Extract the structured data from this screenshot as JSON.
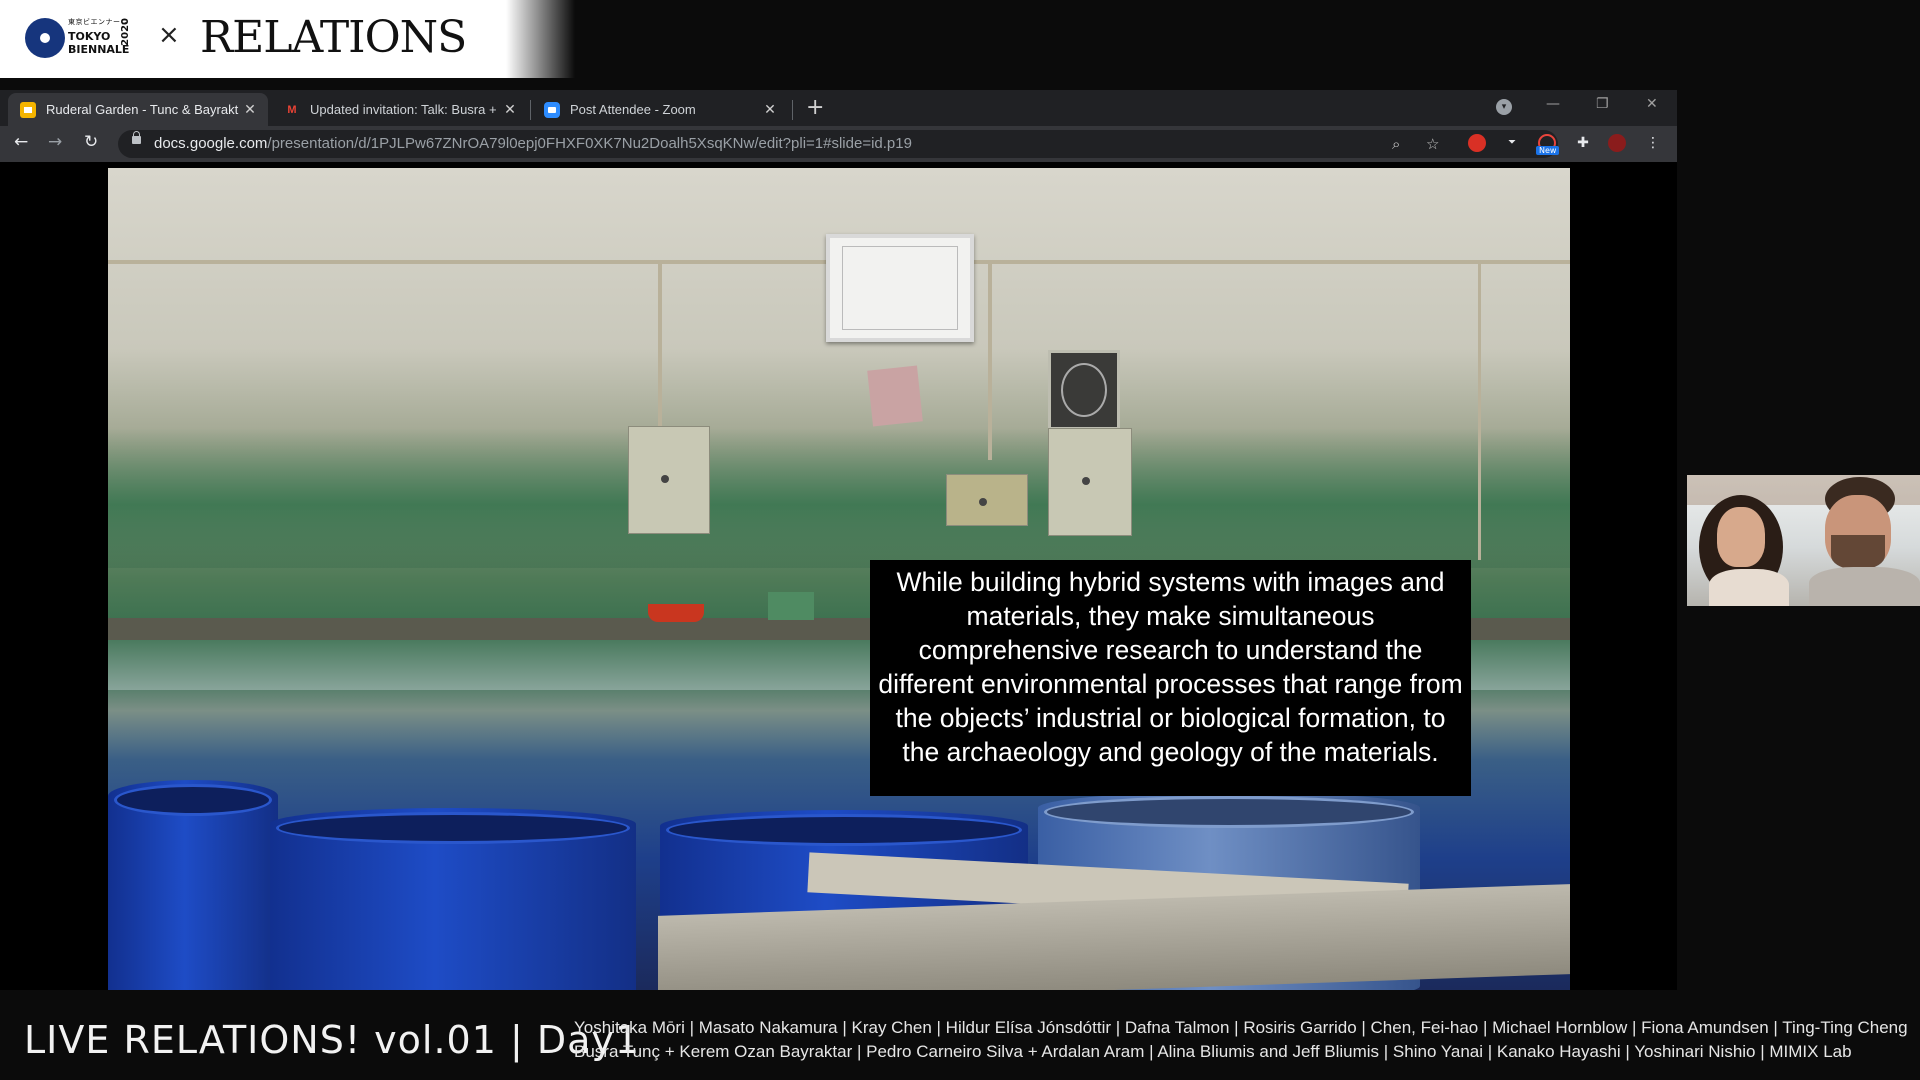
{
  "banner": {
    "logo_jp": "東京ビエンナーレ",
    "logo_line1": "TOKYO",
    "logo_line2": "BIENNALE",
    "logo_year": "2020",
    "cross": "×",
    "title": "RELATIONS"
  },
  "browser": {
    "tabs": [
      {
        "title": "Ruderal Garden - Tunc & Bayrakt",
        "favicon": "slides-icon",
        "active": true
      },
      {
        "title": "Updated invitation: Talk: Busra +",
        "favicon": "gmail-icon",
        "active": false
      },
      {
        "title": "Post Attendee - Zoom",
        "favicon": "zoom-icon",
        "active": false
      }
    ],
    "close_glyph": "✕",
    "new_tab_glyph": "+",
    "url_host": "docs.google.com",
    "url_path": "/presentation/d/1PJLPw67ZNrOA79l0epj0FHXF0XK7Nu2Doalh5XsqKNw/edit?pli=1#slide=id.p19",
    "ext_badge": "New"
  },
  "slide": {
    "caption": "While building hybrid systems with images and materials, they make simultaneous comprehensive research to understand the different environmental processes that range from the objects’ industrial or biological formation, to the archaeology and geology of the materials."
  },
  "footer": {
    "event_title": "LIVE RELATIONS! vol.01 | Day1",
    "participants_line1": "Yoshitaka Mōri | Masato Nakamura | Kray Chen | Hildur Elísa Jónsdóttir | Dafna Talmon | Rosiris Garrido | Chen, Fei-hao | Michael Hornblow | Fiona Amundsen | Ting-Ting Cheng",
    "participants_line2": "Buşra Tunç + Kerem Ozan Bayraktar | Pedro Carneiro Silva + Ardalan Aram | Alina Bliumis and Jeff Bliumis | Shino Yanai | Kanako Hayashi | Yoshinari Nishio | MIMIX Lab"
  },
  "colors": {
    "tabbar": "#202124",
    "toolbar": "#35363a",
    "biennale_blue": "#16357d"
  }
}
